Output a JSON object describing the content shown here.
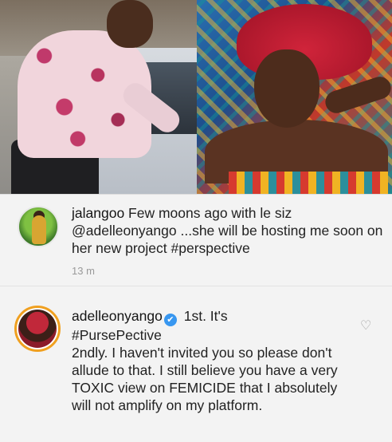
{
  "comments": [
    {
      "username": "jalangoo",
      "text": "Few moons ago with le siz @adelleonyango ...she will be hosting me soon on her new project #perspective",
      "time": "13 m"
    },
    {
      "username": "adelleonyango",
      "verified_icon": "✔",
      "text_line1": "1st. It's",
      "text_line2": "#PursePective",
      "text_rest": "2ndly. I haven't invited you so please don't allude to that. I still believe you have a very TOXIC view on FEMICIDE that I absolutely will not amplify on my platform.",
      "like_icon": "♡"
    }
  ],
  "colors": {
    "verified_badge": "#3897f0",
    "story_ring": "#f0a020",
    "timestamp": "#9a9a9a"
  }
}
